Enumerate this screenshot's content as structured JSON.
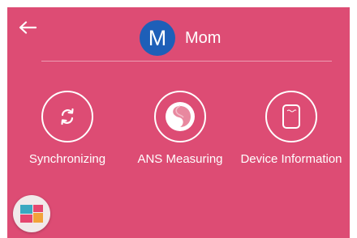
{
  "header": {
    "back_icon": "arrow-left-icon",
    "avatar_letter": "M",
    "avatar_color": "#1e5fb8",
    "profile_name": "Mom"
  },
  "actions": [
    {
      "label": "Synchronizing",
      "icon": "sync-icon"
    },
    {
      "label": "ANS Measuring",
      "icon": "ans-measure-icon"
    },
    {
      "label": "Device Information",
      "icon": "device-icon"
    }
  ],
  "fab": {
    "icon": "apps-grid-icon"
  },
  "colors": {
    "background": "#dd4c74",
    "accent": "#ffffff",
    "fab_background": "#f1e9ea"
  }
}
